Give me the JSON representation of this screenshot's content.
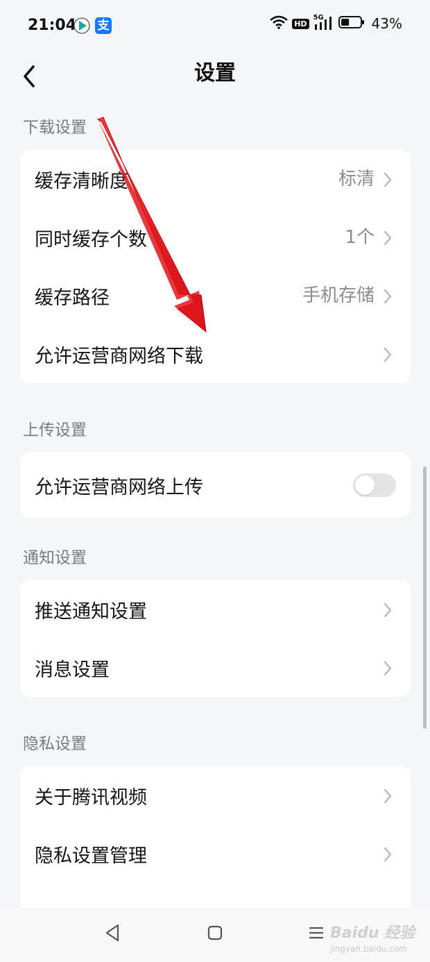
{
  "status_bar": {
    "time": "21:04",
    "network_badge": "HD",
    "network_type": "5G",
    "battery_percent": "43%",
    "battery_level": 0.43,
    "icons": [
      "video-app-icon",
      "alipay-icon",
      "wifi-icon",
      "hd-icon",
      "signal-icon",
      "battery-icon"
    ]
  },
  "header": {
    "title": "设置"
  },
  "sections": {
    "download": {
      "label": "下载设置",
      "rows": [
        {
          "label": "缓存清晰度",
          "value": "标清"
        },
        {
          "label": "同时缓存个数",
          "value": "1个"
        },
        {
          "label": "缓存路径",
          "value": "手机存储"
        },
        {
          "label": "允许运营商网络下载",
          "value": ""
        }
      ]
    },
    "upload": {
      "label": "上传设置",
      "rows": [
        {
          "label": "允许运营商网络上传",
          "toggle_on": false
        }
      ]
    },
    "notify": {
      "label": "通知设置",
      "rows": [
        {
          "label": "推送通知设置"
        },
        {
          "label": "消息设置"
        }
      ]
    },
    "privacy": {
      "label": "隐私设置",
      "rows": [
        {
          "label": "关于腾讯视频"
        },
        {
          "label": "隐私设置管理"
        }
      ]
    }
  },
  "watermark": {
    "brand": "Baidu 经验",
    "site": "jingyan.baidu.com"
  },
  "colors": {
    "page_bg": "#f5f6f8",
    "card_bg": "#ffffff",
    "arrow": "#e0161b",
    "secondary_text": "#8c8c8c"
  }
}
